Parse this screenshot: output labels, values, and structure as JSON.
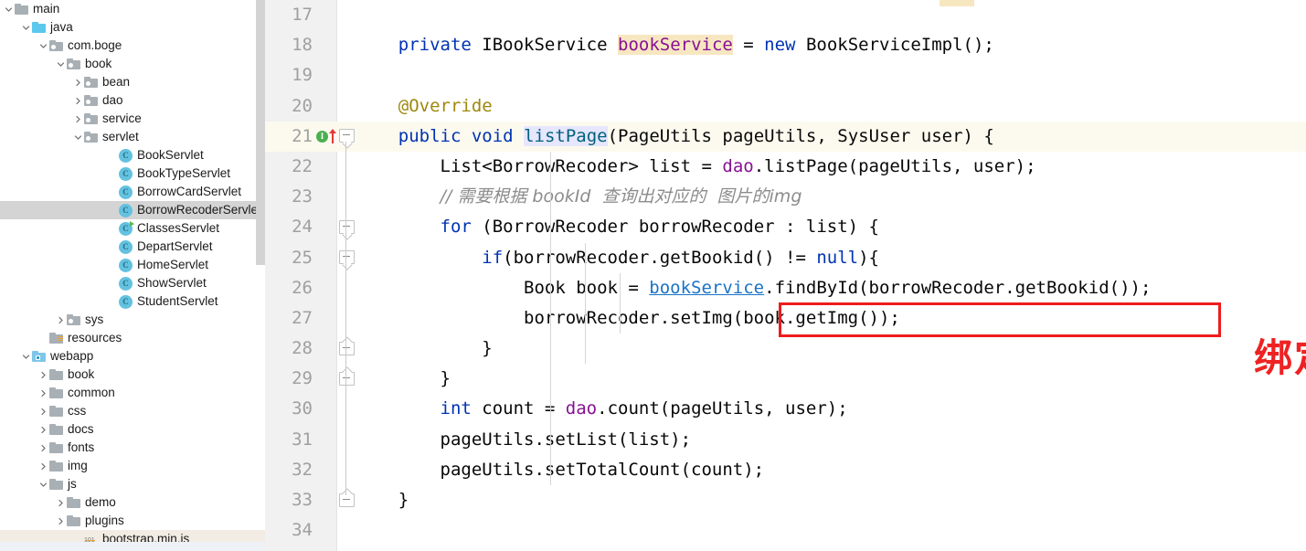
{
  "window": {
    "app": "IntelliJ IDEA code editor"
  },
  "sidebar": {
    "name": "project-tree",
    "scrollbar": {
      "visible": true
    },
    "items": [
      {
        "label": "main",
        "indent": 0,
        "arrow": "down",
        "icon": "folder-gray",
        "selected": false
      },
      {
        "label": "java",
        "indent": 1,
        "arrow": "down",
        "icon": "folder-blue",
        "selected": false
      },
      {
        "label": "com.boge",
        "indent": 2,
        "arrow": "down",
        "icon": "folder-pkg",
        "selected": false
      },
      {
        "label": "book",
        "indent": 3,
        "arrow": "down",
        "icon": "folder-pkg",
        "selected": false
      },
      {
        "label": "bean",
        "indent": 4,
        "arrow": "right",
        "icon": "folder-pkg",
        "selected": false
      },
      {
        "label": "dao",
        "indent": 4,
        "arrow": "right",
        "icon": "folder-pkg",
        "selected": false
      },
      {
        "label": "service",
        "indent": 4,
        "arrow": "right",
        "icon": "folder-pkg",
        "selected": false
      },
      {
        "label": "servlet",
        "indent": 4,
        "arrow": "down",
        "icon": "folder-pkg",
        "selected": false
      },
      {
        "label": "BookServlet",
        "indent": 6,
        "arrow": "none",
        "icon": "java-class",
        "selected": false
      },
      {
        "label": "BookTypeServlet",
        "indent": 6,
        "arrow": "none",
        "icon": "java-class",
        "selected": false
      },
      {
        "label": "BorrowCardServlet",
        "indent": 6,
        "arrow": "none",
        "icon": "java-class",
        "selected": false
      },
      {
        "label": "BorrowRecoderServlet",
        "indent": 6,
        "arrow": "none",
        "icon": "java-class",
        "selected": true
      },
      {
        "label": "ClassesServlet",
        "indent": 6,
        "arrow": "none",
        "icon": "java-class-run",
        "selected": false
      },
      {
        "label": "DepartServlet",
        "indent": 6,
        "arrow": "none",
        "icon": "java-class",
        "selected": false
      },
      {
        "label": "HomeServlet",
        "indent": 6,
        "arrow": "none",
        "icon": "java-class",
        "selected": false
      },
      {
        "label": "ShowServlet",
        "indent": 6,
        "arrow": "none",
        "icon": "java-class",
        "selected": false
      },
      {
        "label": "StudentServlet",
        "indent": 6,
        "arrow": "none",
        "icon": "java-class",
        "selected": false
      },
      {
        "label": "sys",
        "indent": 3,
        "arrow": "right",
        "icon": "folder-pkg",
        "selected": false
      },
      {
        "label": "resources",
        "indent": 2,
        "arrow": "none",
        "icon": "folder-res",
        "selected": false
      },
      {
        "label": "webapp",
        "indent": 1,
        "arrow": "down",
        "icon": "folder-web",
        "selected": false
      },
      {
        "label": "book",
        "indent": 2,
        "arrow": "right",
        "icon": "folder-gray",
        "selected": false
      },
      {
        "label": "common",
        "indent": 2,
        "arrow": "right",
        "icon": "folder-gray",
        "selected": false
      },
      {
        "label": "css",
        "indent": 2,
        "arrow": "right",
        "icon": "folder-gray",
        "selected": false
      },
      {
        "label": "docs",
        "indent": 2,
        "arrow": "right",
        "icon": "folder-gray",
        "selected": false
      },
      {
        "label": "fonts",
        "indent": 2,
        "arrow": "right",
        "icon": "folder-gray",
        "selected": false
      },
      {
        "label": "img",
        "indent": 2,
        "arrow": "right",
        "icon": "folder-gray",
        "selected": false
      },
      {
        "label": "js",
        "indent": 2,
        "arrow": "down",
        "icon": "folder-gray",
        "selected": false
      },
      {
        "label": "demo",
        "indent": 3,
        "arrow": "right",
        "icon": "folder-gray",
        "selected": false
      },
      {
        "label": "plugins",
        "indent": 3,
        "arrow": "right",
        "icon": "folder-gray",
        "selected": false
      },
      {
        "label": "bootstrap.min.js",
        "indent": 4,
        "arrow": "none",
        "icon": "js-file",
        "selected": false,
        "faint": true
      }
    ]
  },
  "editor": {
    "name": "java-code-editor",
    "current_line": 21,
    "first_visible_line": 17,
    "last_visible_line": 34,
    "lines": [
      {
        "n": 17,
        "indent": 0,
        "fold": "none",
        "gutter_icons": [],
        "current": false,
        "tokens": []
      },
      {
        "n": 18,
        "indent": 0,
        "fold": "none",
        "gutter_icons": [],
        "current": false,
        "tokens": [
          {
            "t": "    ",
            "c": "plain"
          },
          {
            "t": "private",
            "c": "kw"
          },
          {
            "t": " IBookService ",
            "c": "plain"
          },
          {
            "t": "bookService",
            "c": "field hl-use"
          },
          {
            "t": " = ",
            "c": "plain"
          },
          {
            "t": "new",
            "c": "kw"
          },
          {
            "t": " BookServiceImpl();",
            "c": "plain"
          }
        ]
      },
      {
        "n": 19,
        "indent": 0,
        "fold": "none",
        "gutter_icons": [],
        "current": false,
        "tokens": []
      },
      {
        "n": 20,
        "indent": 0,
        "fold": "none",
        "gutter_icons": [],
        "current": false,
        "tokens": [
          {
            "t": "    ",
            "c": "plain"
          },
          {
            "t": "@Override",
            "c": "anno"
          }
        ]
      },
      {
        "n": 21,
        "indent": 0,
        "fold": "open",
        "gutter_icons": [
          "implemented-badge",
          "override-arrow"
        ],
        "current": true,
        "tokens": [
          {
            "t": "    ",
            "c": "plain"
          },
          {
            "t": "public",
            "c": "kw"
          },
          {
            "t": " ",
            "c": "plain"
          },
          {
            "t": "void",
            "c": "kw"
          },
          {
            "t": " ",
            "c": "plain"
          },
          {
            "t": "listPage",
            "c": "meth hl-decl"
          },
          {
            "t": "(PageUtils pageUtils, SysUser user) {",
            "c": "plain"
          }
        ]
      },
      {
        "n": 22,
        "indent": 1,
        "fold": "none",
        "gutter_icons": [],
        "current": false,
        "tokens": [
          {
            "t": "        List<BorrowRecoder> list = ",
            "c": "plain"
          },
          {
            "t": "dao",
            "c": "field"
          },
          {
            "t": ".listPage(pageUtils, user);",
            "c": "plain"
          }
        ]
      },
      {
        "n": 23,
        "indent": 1,
        "fold": "none",
        "gutter_icons": [],
        "current": false,
        "tokens": [
          {
            "t": "        ",
            "c": "plain"
          },
          {
            "t": "// 需要根据 bookId  查询出对应的  图片的img",
            "c": "cmt-cn"
          }
        ]
      },
      {
        "n": 24,
        "indent": 1,
        "fold": "open",
        "gutter_icons": [],
        "current": false,
        "tokens": [
          {
            "t": "        ",
            "c": "plain"
          },
          {
            "t": "for",
            "c": "kw"
          },
          {
            "t": " (BorrowRecoder borrowRecoder : list) {",
            "c": "plain"
          }
        ]
      },
      {
        "n": 25,
        "indent": 2,
        "fold": "open",
        "gutter_icons": [],
        "current": false,
        "tokens": [
          {
            "t": "            ",
            "c": "plain"
          },
          {
            "t": "if",
            "c": "kw"
          },
          {
            "t": "(borrowRecoder.getBookid() != ",
            "c": "plain"
          },
          {
            "t": "null",
            "c": "kw"
          },
          {
            "t": "){",
            "c": "plain"
          }
        ]
      },
      {
        "n": 26,
        "indent": 3,
        "fold": "none",
        "gutter_icons": [],
        "current": false,
        "tokens": [
          {
            "t": "                Book book = ",
            "c": "plain"
          },
          {
            "t": "bookService",
            "c": "meth-u"
          },
          {
            "t": ".findById(borrowRecoder.getBookid());",
            "c": "plain"
          }
        ]
      },
      {
        "n": 27,
        "indent": 3,
        "fold": "none",
        "gutter_icons": [],
        "current": false,
        "tokens": [
          {
            "t": "                borrowRecoder.setImg(book.getImg());",
            "c": "plain"
          }
        ]
      },
      {
        "n": 28,
        "indent": 2,
        "fold": "close",
        "gutter_icons": [],
        "current": false,
        "tokens": [
          {
            "t": "            }",
            "c": "plain"
          }
        ]
      },
      {
        "n": 29,
        "indent": 1,
        "fold": "close",
        "gutter_icons": [],
        "current": false,
        "tokens": [
          {
            "t": "        }",
            "c": "plain"
          }
        ]
      },
      {
        "n": 30,
        "indent": 1,
        "fold": "none",
        "gutter_icons": [],
        "current": false,
        "tokens": [
          {
            "t": "        ",
            "c": "plain"
          },
          {
            "t": "int",
            "c": "kw"
          },
          {
            "t": " count = ",
            "c": "plain"
          },
          {
            "t": "dao",
            "c": "field"
          },
          {
            "t": ".count(pageUtils, user);",
            "c": "plain"
          }
        ]
      },
      {
        "n": 31,
        "indent": 1,
        "fold": "none",
        "gutter_icons": [],
        "current": false,
        "tokens": [
          {
            "t": "        pageUtils.setList(list);",
            "c": "plain"
          }
        ]
      },
      {
        "n": 32,
        "indent": 1,
        "fold": "none",
        "gutter_icons": [],
        "current": false,
        "tokens": [
          {
            "t": "        pageUtils.setTotalCount(count);",
            "c": "plain"
          }
        ]
      },
      {
        "n": 33,
        "indent": 0,
        "fold": "close",
        "gutter_icons": [],
        "current": false,
        "tokens": [
          {
            "t": "    }",
            "c": "plain"
          }
        ]
      },
      {
        "n": 34,
        "indent": 0,
        "fold": "none",
        "gutter_icons": [],
        "current": false,
        "tokens": []
      }
    ]
  },
  "annotations": {
    "red_box": {
      "name": "red-highlight-box",
      "target_code": "borrowRecoder.setImg(book.getImg());",
      "color": "#ee1c1c"
    },
    "red_note": {
      "name": "red-annotation-text",
      "text": "绑定图片",
      "color": "#ee2222"
    }
  },
  "colors": {
    "keyword": "#0033b3",
    "annotation": "#9e880d",
    "field": "#871094",
    "method": "#00627a",
    "comment": "#8c8c8c",
    "usage_highlight": "#f7e7c1",
    "declaration_highlight": "#e6e6ff",
    "current_line": "#fcfaef",
    "selection": "#d4d4d4",
    "gutter_bg": "#f1f1f1"
  }
}
